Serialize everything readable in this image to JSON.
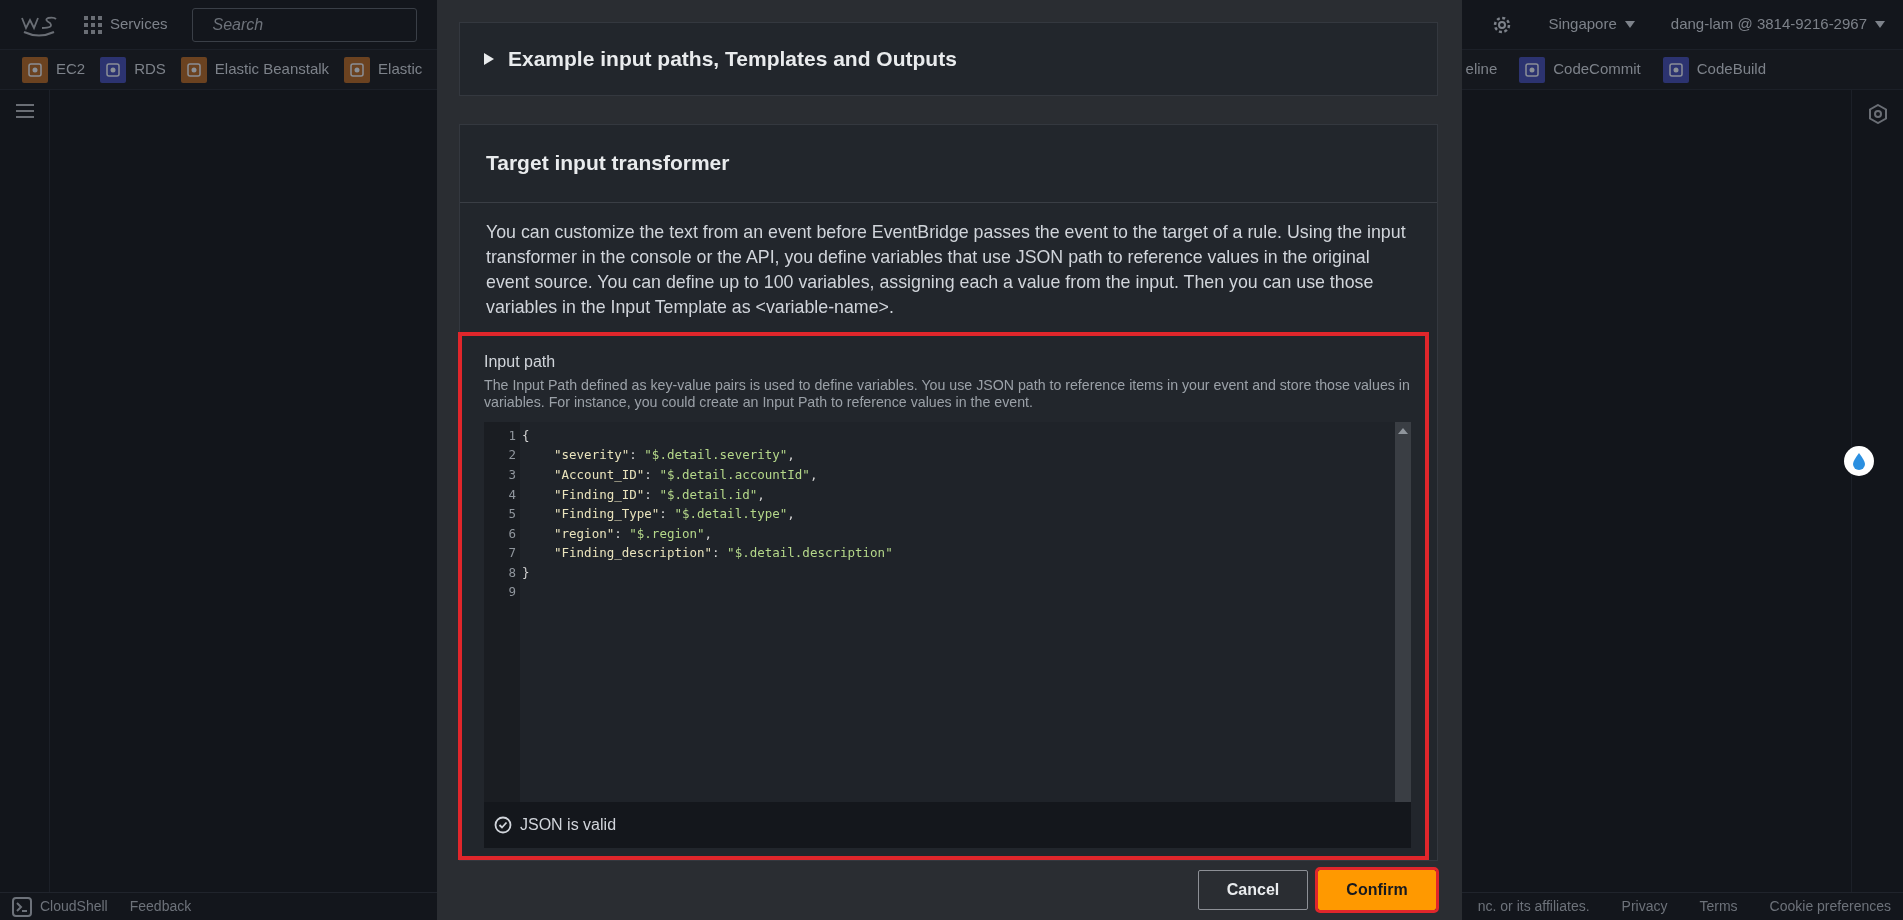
{
  "top_nav": {
    "services": "Services",
    "search": {
      "placeholder": "Search"
    },
    "region": "Singapore",
    "account": "dang-lam @ 3814-9216-2967"
  },
  "favorites": [
    {
      "label": "EC2",
      "color": "#6b4220"
    },
    {
      "label": "RDS",
      "color": "#2c3370"
    },
    {
      "label": "Elastic Beanstalk",
      "color": "#6b4220"
    },
    {
      "label": "Elastic",
      "color": "#6b4220"
    }
  ],
  "favorites_right": [
    {
      "label": "eline"
    },
    {
      "label": "CodeCommit",
      "color": "#2c3370"
    },
    {
      "label": "CodeBuild",
      "color": "#2c3370"
    }
  ],
  "footer": {
    "cloudshell": "CloudShell",
    "feedback": "Feedback",
    "copyright": "nc. or its affiliates.",
    "links": [
      "Privacy",
      "Terms",
      "Cookie preferences"
    ]
  },
  "modal": {
    "example_section": {
      "title": "Example input paths, Templates and Outputs",
      "expanded": false
    },
    "transformer": {
      "title": "Target input transformer",
      "description": "You can customize the text from an event before EventBridge passes the event to the target of a rule. Using the input transformer in the console or the API, you define variables that use JSON path to reference values in the original event source. You can define up to 100 variables, assigning each a value from the input. Then you can use those variables in the Input Template as <variable-name>.",
      "input_path": {
        "label": "Input path",
        "highlighted": true,
        "hint": "The Input Path defined as key-value pairs is used to define variables. You use JSON path to reference items in your event and store those values in variables. For instance, you could create an Input Path to reference values in the event.",
        "lines": [
          {
            "number": "1",
            "tokens": [
              {
                "kind": "punct",
                "text": "{"
              }
            ],
            "children": [
              {
                "number": "2",
                "tokens": [
                  {
                    "kind": "key",
                    "text": "\"severity\""
                  },
                  {
                    "kind": "punct",
                    "text": ": "
                  },
                  {
                    "kind": "string",
                    "text": "\"$.detail.severity\""
                  },
                  {
                    "kind": "punct",
                    "text": ","
                  }
                ]
              },
              {
                "number": "3",
                "tokens": [
                  {
                    "kind": "key",
                    "text": "\"Account_ID\""
                  },
                  {
                    "kind": "punct",
                    "text": ": "
                  },
                  {
                    "kind": "string",
                    "text": "\"$.detail.accountId\""
                  },
                  {
                    "kind": "punct",
                    "text": ","
                  }
                ]
              },
              {
                "number": "4",
                "tokens": [
                  {
                    "kind": "key",
                    "text": "\"Finding_ID\""
                  },
                  {
                    "kind": "punct",
                    "text": ": "
                  },
                  {
                    "kind": "string",
                    "text": "\"$.detail.id\""
                  },
                  {
                    "kind": "punct",
                    "text": ","
                  }
                ]
              },
              {
                "number": "5",
                "tokens": [
                  {
                    "kind": "key",
                    "text": "\"Finding_Type\""
                  },
                  {
                    "kind": "punct",
                    "text": ": "
                  },
                  {
                    "kind": "string",
                    "text": "\"$.detail.type\""
                  },
                  {
                    "kind": "punct",
                    "text": ","
                  }
                ]
              },
              {
                "number": "6",
                "tokens": [
                  {
                    "kind": "key",
                    "text": "\"region\""
                  },
                  {
                    "kind": "punct",
                    "text": ": "
                  },
                  {
                    "kind": "string",
                    "text": "\"$.region\""
                  },
                  {
                    "kind": "punct",
                    "text": ","
                  }
                ]
              },
              {
                "number": "7",
                "tokens": [
                  {
                    "kind": "key",
                    "text": "\"Finding_description\""
                  },
                  {
                    "kind": "punct",
                    "text": ": "
                  },
                  {
                    "kind": "string",
                    "text": "\"$.detail.description\""
                  }
                ]
              }
            ]
          },
          {
            "number": "8",
            "tokens": [
              {
                "kind": "punct",
                "text": "}"
              }
            ]
          },
          {
            "number": "9"
          }
        ],
        "status": "JSON is valid"
      }
    },
    "buttons": [
      {
        "label": "Cancel",
        "kind": "secondary",
        "highlighted": false
      },
      {
        "label": "Confirm",
        "kind": "primary",
        "highlighted": true
      }
    ]
  }
}
